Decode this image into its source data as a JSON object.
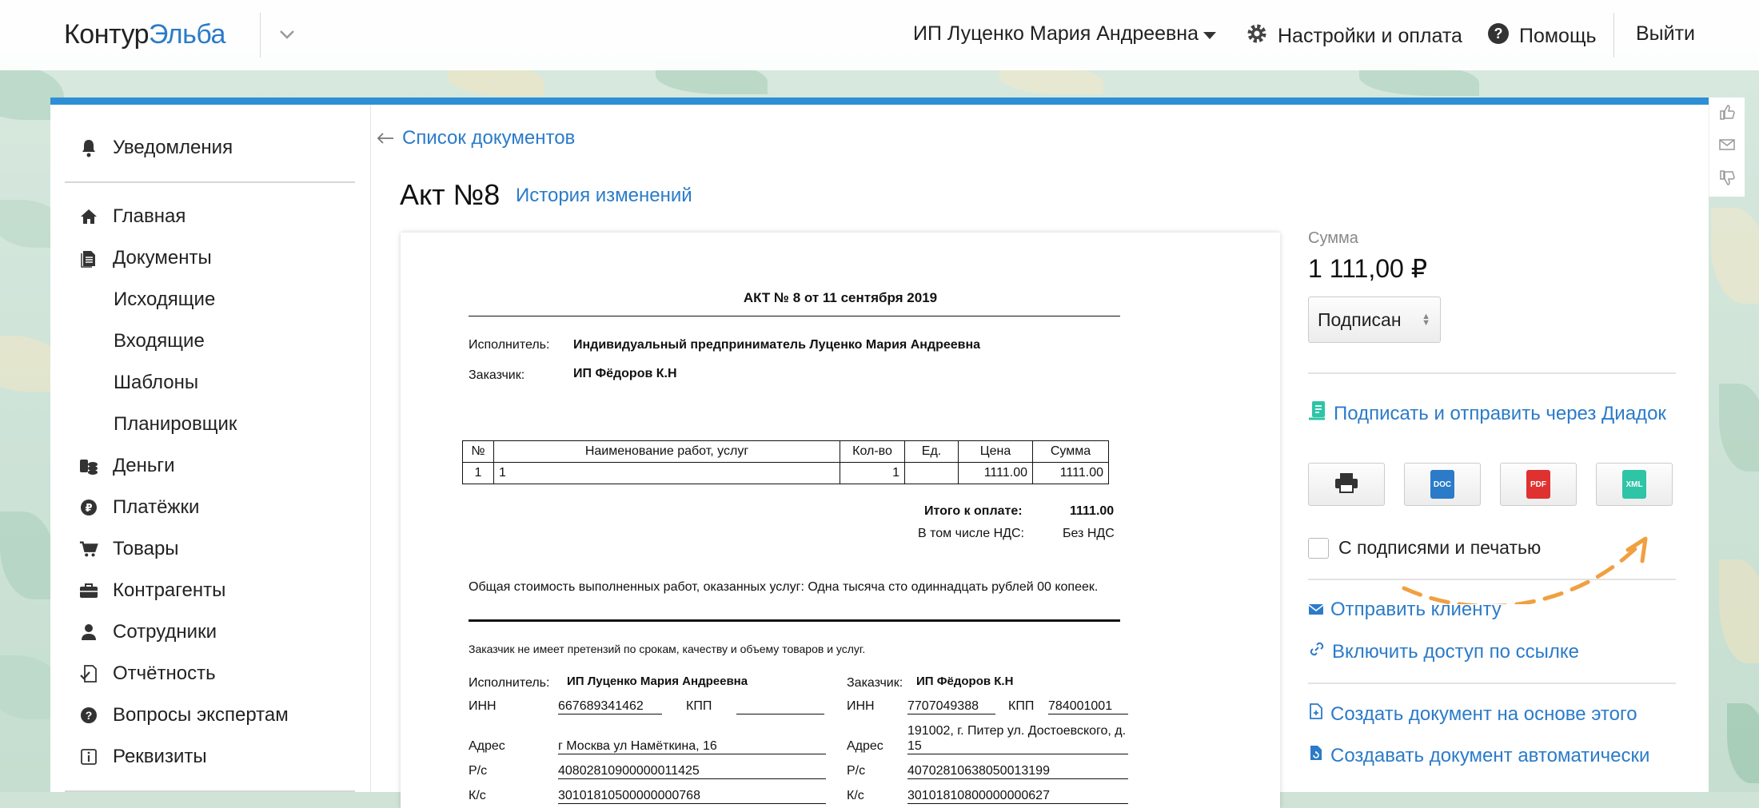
{
  "header": {
    "logo_part1": "Контур",
    "logo_part2": "Эльба",
    "user_name": "ИП Луценко Мария Андреевна",
    "settings_label": "Настройки и оплата",
    "help_label": "Помощь",
    "logout_label": "Выйти"
  },
  "sidebar": {
    "notifications": "Уведомления",
    "items": [
      {
        "label": "Главная",
        "icon": "home-icon"
      },
      {
        "label": "Документы",
        "icon": "documents-icon"
      },
      {
        "label": "Деньги",
        "icon": "money-icon"
      },
      {
        "label": "Платёжки",
        "icon": "ruble-icon"
      },
      {
        "label": "Товары",
        "icon": "cart-icon"
      },
      {
        "label": "Контрагенты",
        "icon": "briefcase-icon"
      },
      {
        "label": "Сотрудники",
        "icon": "person-icon"
      },
      {
        "label": "Отчётность",
        "icon": "report-icon"
      },
      {
        "label": "Вопросы экспертам",
        "icon": "question-icon"
      },
      {
        "label": "Реквизиты",
        "icon": "info-icon"
      }
    ],
    "doc_subitems": [
      "Исходящие",
      "Входящие",
      "Шаблоны",
      "Планировщик"
    ]
  },
  "main": {
    "back_link": "Список документов",
    "doc_title": "Акт №8",
    "history_link": "История изменений"
  },
  "document": {
    "title": "АКТ № 8 от 11 сентября 2019",
    "executor_label": "Исполнитель:",
    "executor_value": "Индивидуальный предприниматель Луценко Мария Андреевна",
    "customer_label": "Заказчик:",
    "customer_value": "ИП Фёдоров К.Н",
    "table_headers": [
      "№",
      "Наименование работ, услуг",
      "Кол-во",
      "Ед.",
      "Цена",
      "Сумма"
    ],
    "table_rows": [
      [
        "1",
        "1",
        "1",
        "",
        "1111.00",
        "1111.00"
      ]
    ],
    "total_label": "Итого к оплате:",
    "total_value": "1111.00",
    "vat_label": "В том числе НДС:",
    "vat_value": "Без НДС",
    "amount_words": "Общая стоимость выполненных работ, оказанных услуг: Одна тысяча сто одиннадцать рублей 00 копеек.",
    "no_claims": "Заказчик не имеет претензий по срокам, качеству и объему товаров и услуг.",
    "sig": {
      "exec_label": "Исполнитель:",
      "exec_name": "ИП Луценко Мария Андреевна",
      "cust_label": "Заказчик:",
      "cust_name": "ИП Фёдоров К.Н",
      "inn_label": "ИНН",
      "kpp_label": "КПП",
      "exec_inn": "667689341462",
      "exec_kpp": "",
      "cust_inn": "7707049388",
      "cust_kpp": "784001001",
      "addr_label": "Адрес",
      "exec_addr": "г Москва ул Намёткина, 16",
      "cust_addr": "191002, г. Питер ул. Достоевского, д. 15",
      "rs_label": "Р/с",
      "exec_rs": "40802810900000011425",
      "cust_rs": "40702810638050013199",
      "ks_label": "К/с",
      "exec_ks": "30101810500000000768",
      "cust_ks": "30101810800000000627"
    }
  },
  "panel": {
    "sum_label": "Сумма",
    "sum_value": "1 111,00 ₽",
    "status": "Подписан",
    "diadoc_link": "Подписать и отправить через Диадок",
    "download_buttons": [
      {
        "icon": "printer-icon",
        "label": ""
      },
      {
        "icon": "doc-file-icon",
        "label": "DOC"
      },
      {
        "icon": "pdf-file-icon",
        "label": "PDF"
      },
      {
        "icon": "xml-file-icon",
        "label": "XML"
      }
    ],
    "with_signatures": "С подписями и печатью",
    "send_client": "Отправить клиенту",
    "share_link": "Включить доступ по ссылке",
    "create_based": "Создать документ на основе этого",
    "create_auto": "Создавать документ автоматически"
  },
  "colors": {
    "accent": "#2b7bc9",
    "top_border": "#2f8fd6",
    "doc_icon": "#2b7bc9",
    "pdf_icon": "#e03131",
    "xml_icon": "#2ec4a6",
    "arrow": "#f0a040"
  }
}
